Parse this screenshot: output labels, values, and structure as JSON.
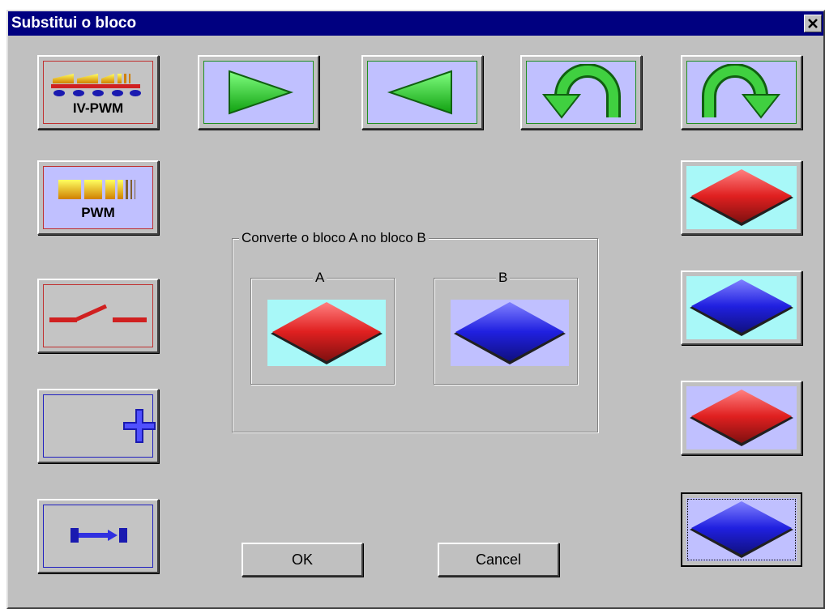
{
  "window": {
    "title": "Substitui o bloco",
    "close_icon": "close-icon"
  },
  "left_buttons": {
    "iv_pwm_label": "IV-PWM",
    "pwm_label": "PWM"
  },
  "group": {
    "legend": "Converte o bloco A no bloco B",
    "a_label": "A",
    "b_label": "B"
  },
  "buttons": {
    "ok_label": "OK",
    "cancel_label": "Cancel"
  },
  "colors": {
    "title_bg": "#000080",
    "dialog_bg": "#c0c0c0",
    "red": "#e02020",
    "blue": "#2020e0",
    "green": "#20c020",
    "cyan": "#a8f8f8",
    "lavender": "#c0c0ff"
  }
}
